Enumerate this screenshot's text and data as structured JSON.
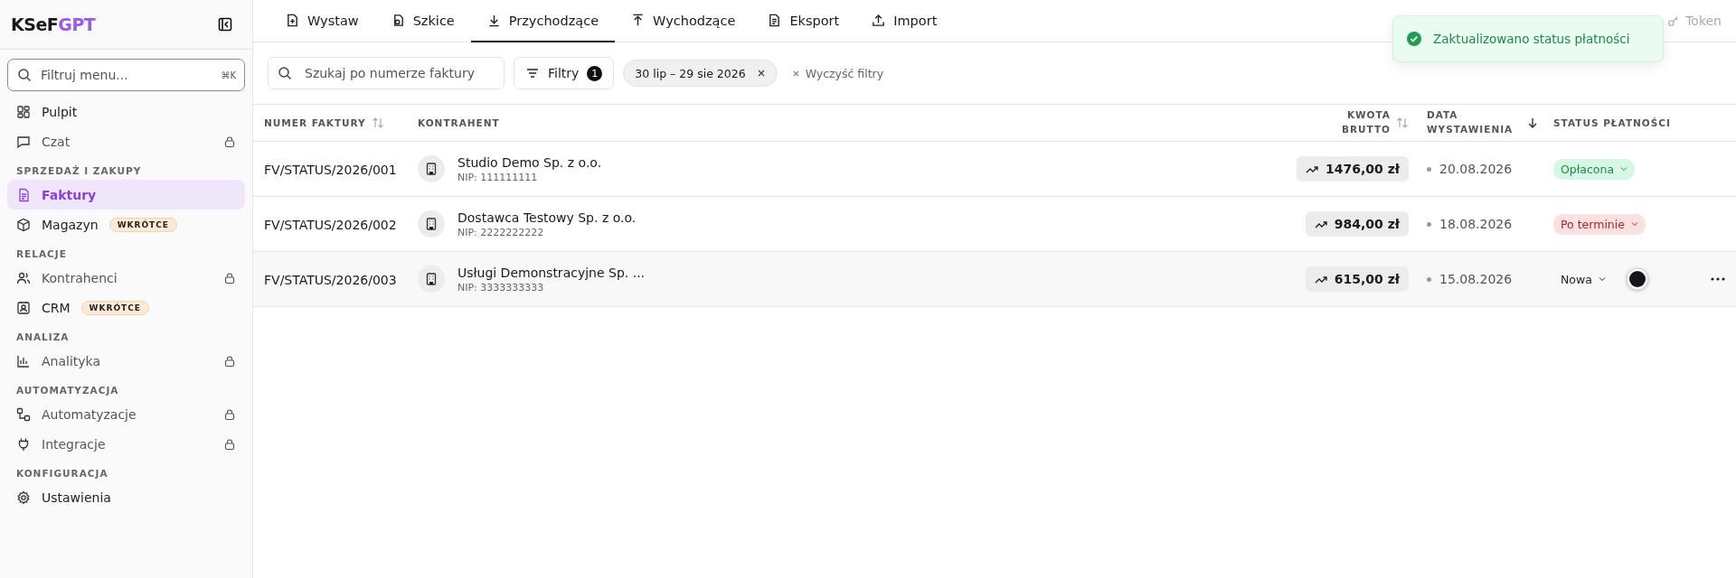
{
  "sidebar": {
    "logo": {
      "main": "KSeF",
      "accent": "GPT"
    },
    "filter": {
      "placeholder": "Filtruj menu...",
      "shortcut": "⌘K"
    },
    "sections": [
      {
        "items": [
          {
            "label": "Pulpit",
            "locked": false,
            "selected": false
          },
          {
            "label": "Czat",
            "locked": true,
            "selected": false
          }
        ]
      },
      {
        "title": "SPRZEDAŻ I ZAKUPY",
        "items": [
          {
            "label": "Faktury",
            "locked": false,
            "selected": true
          },
          {
            "label": "Magazyn",
            "locked": false,
            "selected": false,
            "badge": "WKRÓTCE"
          }
        ]
      },
      {
        "title": "RELACJE",
        "items": [
          {
            "label": "Kontrahenci",
            "locked": true,
            "selected": false
          },
          {
            "label": "CRM",
            "locked": false,
            "selected": false,
            "badge": "WKRÓTCE"
          }
        ]
      },
      {
        "title": "ANALIZA",
        "items": [
          {
            "label": "Analityka",
            "locked": true,
            "selected": false
          }
        ]
      },
      {
        "title": "AUTOMATYZACJA",
        "items": [
          {
            "label": "Automatyzacje",
            "locked": true,
            "selected": false
          },
          {
            "label": "Integracje",
            "locked": true,
            "selected": false
          }
        ]
      },
      {
        "title": "KONFIGURACJA",
        "items": [
          {
            "label": "Ustawienia",
            "locked": false,
            "selected": false
          }
        ]
      }
    ]
  },
  "tabs": [
    {
      "label": "Wystaw",
      "selected": false
    },
    {
      "label": "Szkice",
      "selected": false
    },
    {
      "label": "Przychodzące",
      "selected": true
    },
    {
      "label": "Wychodzące",
      "selected": false
    },
    {
      "label": "Eksport",
      "selected": false
    },
    {
      "label": "Import",
      "selected": false
    }
  ],
  "token_link": "Token",
  "toolbar": {
    "search_placeholder": "Szukaj po numerze faktury",
    "filters_label": "Filtry",
    "filters_count": "1",
    "chip": "30 lip – 29 sie 2026",
    "clear": "Wyczyść filtry"
  },
  "toast": {
    "message": "Zaktualizowano status płatności"
  },
  "table": {
    "columns": [
      "NUMER FAKTURY",
      "KONTRAHENT",
      "KWOTA BRUTTO",
      "DATA WYSTAWIENIA",
      "STATUS PŁATNOŚCI"
    ],
    "rows": [
      {
        "number": "FV/STATUS/2026/001",
        "name": "Studio Demo Sp. z o.o.",
        "nip": "NIP: 111111111",
        "amount": "1476,00 zł",
        "date": "20.08.2026",
        "status": "Opłacona",
        "kind": "paid",
        "hovered": false
      },
      {
        "number": "FV/STATUS/2026/002",
        "name": "Dostawca Testowy Sp. z o.o.",
        "nip": "NIP: 2222222222",
        "amount": "984,00 zł",
        "date": "18.08.2026",
        "status": "Po terminie",
        "kind": "overdue",
        "hovered": false
      },
      {
        "number": "FV/STATUS/2026/003",
        "name": "Usługi Demonstracyjne Sp. ...",
        "nip": "NIP: 3333333333",
        "amount": "615,00 zł",
        "date": "15.08.2026",
        "status": "Nowa",
        "kind": "new",
        "hovered": true
      }
    ]
  }
}
